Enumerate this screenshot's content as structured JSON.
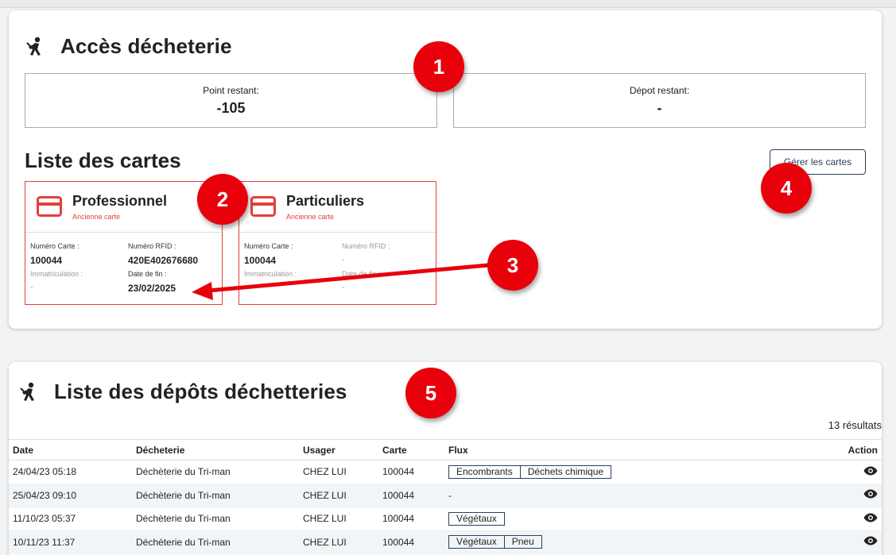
{
  "access": {
    "title": "Accès décheterie",
    "points_label": "Point restant:",
    "points_value": "-105",
    "depot_label": "Dépot restant:",
    "depot_value": "-"
  },
  "cards_section": {
    "title": "Liste des cartes",
    "manage_button": "Gérer les cartes",
    "cards": [
      {
        "name": "Professionnel",
        "subtitle": "Ancienne carte",
        "numero_label": "Numéro Carte :",
        "numero_value": "100044",
        "rfid_label": "Numéro RFID :",
        "rfid_value": "420E402676680",
        "immat_label": "Immatriculation :",
        "immat_value": "-",
        "fin_label": "Date de fin :",
        "fin_value": "23/02/2025"
      },
      {
        "name": "Particuliers",
        "subtitle": "Ancienne carte",
        "numero_label": "Numéro Carte :",
        "numero_value": "100044",
        "rfid_label": "Numéro RFID :",
        "rfid_value": "-",
        "immat_label": "Immatriculation :",
        "immat_value": "-",
        "fin_label": "Date de fin :",
        "fin_value": "-"
      }
    ]
  },
  "depots": {
    "title": "Liste des dépôts déchetteries",
    "results": "13 résultats",
    "columns": [
      "Date",
      "Décheterie",
      "Usager",
      "Carte",
      "Flux",
      "Action"
    ],
    "rows": [
      {
        "date": "24/04/23 05:18",
        "decheterie": "Déchèterie du Tri-man",
        "usager": "CHEZ LUI",
        "carte": "100044",
        "flux": [
          "Encombrants",
          "Déchets chimique"
        ]
      },
      {
        "date": "25/04/23 09:10",
        "decheterie": "Déchèterie du Tri-man",
        "usager": "CHEZ LUI",
        "carte": "100044",
        "flux": []
      },
      {
        "date": "11/10/23 05:37",
        "decheterie": "Déchèterie du Tri-man",
        "usager": "CHEZ LUI",
        "carte": "100044",
        "flux": [
          "Végétaux"
        ]
      },
      {
        "date": "10/11/23 11:37",
        "decheterie": "Déchèterie du Tri-man",
        "usager": "CHEZ LUI",
        "carte": "100044",
        "flux": [
          "Végétaux",
          "Pneu"
        ]
      }
    ],
    "empty_flux": "-"
  },
  "annotations": [
    "1",
    "2",
    "3",
    "4",
    "5"
  ],
  "colors": {
    "accent_red": "#e0413b",
    "badge_red": "#e8000b",
    "navy": "#2b3f5c"
  },
  "icons": {
    "section": "road-worker-icon",
    "card": "credit-card-icon",
    "action": "eye-icon"
  }
}
